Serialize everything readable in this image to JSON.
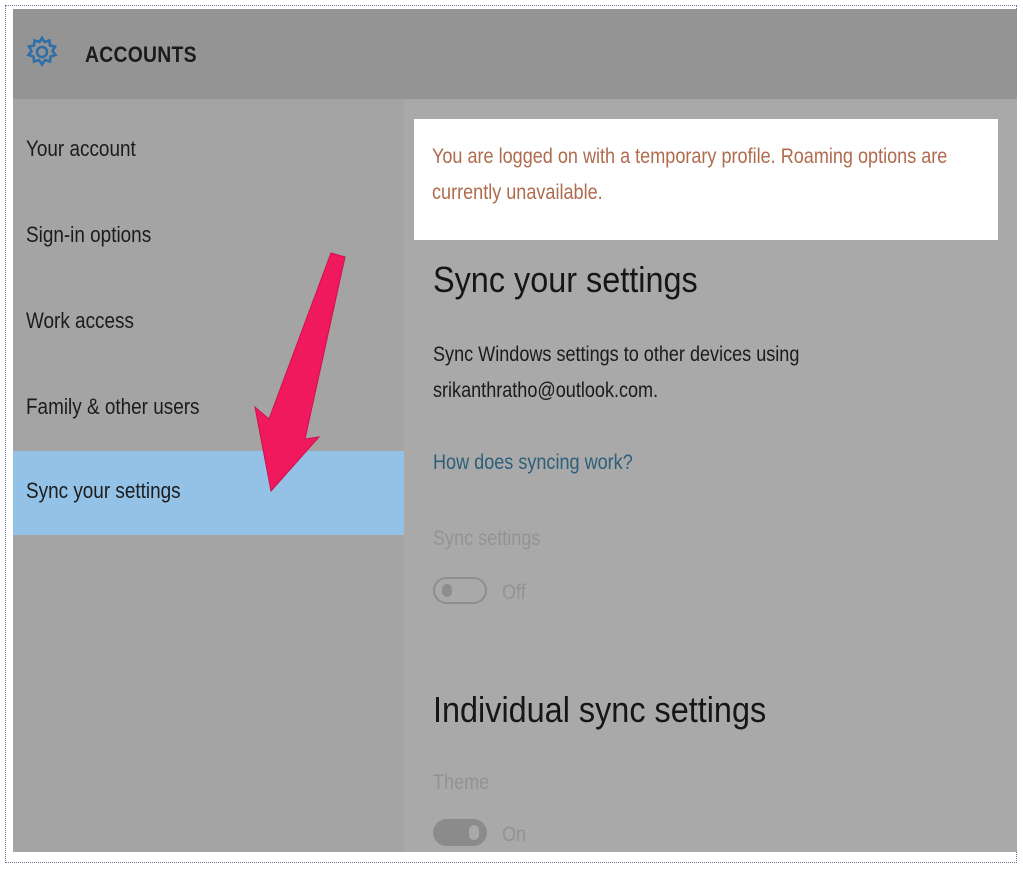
{
  "header": {
    "title": "ACCOUNTS",
    "icon": "gear-icon"
  },
  "sidebar": {
    "items": [
      {
        "label": "Your account",
        "selected": false
      },
      {
        "label": "Sign-in options",
        "selected": false
      },
      {
        "label": "Work access",
        "selected": false
      },
      {
        "label": "Family & other users",
        "selected": false
      },
      {
        "label": "Sync your settings",
        "selected": true
      }
    ]
  },
  "main": {
    "banner_text": "You are logged on with a temporary profile. Roaming options are currently unavailable.",
    "heading": "Sync your settings",
    "description": "Sync Windows settings to other devices using srikanthratho@outlook.com.",
    "help_link": "How does syncing work?",
    "sync_settings": {
      "label": "Sync settings",
      "state_label": "Off",
      "enabled": false
    },
    "individual_heading": "Individual sync settings",
    "theme": {
      "label": "Theme",
      "state_label": "On",
      "enabled": true
    }
  },
  "annotation": {
    "icon": "arrow-icon",
    "color": "#f0195e"
  },
  "colors": {
    "selected_item": "#93c2e6",
    "banner_text": "#b06a4c",
    "link": "#2d5f7a"
  }
}
